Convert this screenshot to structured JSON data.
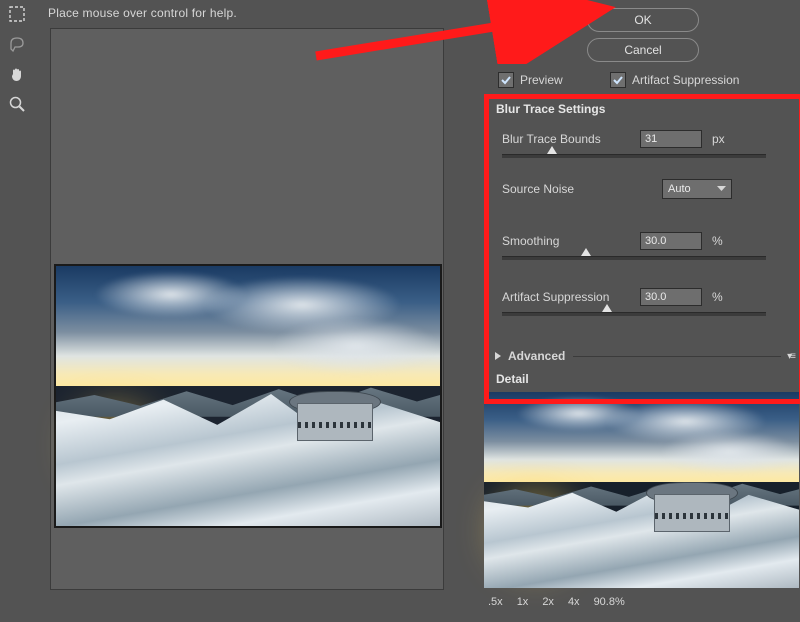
{
  "hint": "Place mouse over control for help.",
  "annotation": {
    "arrow_color": "#ff1a1a"
  },
  "buttons": {
    "ok": "OK",
    "cancel": "Cancel"
  },
  "preview_checkbox": {
    "label": "Preview",
    "checked": true
  },
  "artifact_checkbox": {
    "label": "Artifact Suppression",
    "checked": true
  },
  "blur_trace_settings": {
    "title": "Blur Trace Settings",
    "bounds": {
      "label": "Blur Trace Bounds",
      "value": "31",
      "unit": "px",
      "slider_pos_pct": 17
    },
    "source_noise": {
      "label": "Source Noise",
      "selected": "Auto"
    },
    "smoothing": {
      "label": "Smoothing",
      "value": "30.0",
      "unit": "%",
      "slider_pos_pct": 30
    },
    "artifact": {
      "label": "Artifact Suppression",
      "value": "30.0",
      "unit": "%",
      "slider_pos_pct": 38
    }
  },
  "advanced": {
    "label": "Advanced"
  },
  "detail": {
    "title": "Detail"
  },
  "zoom": {
    "levels": [
      ".5x",
      "1x",
      "2x",
      "4x"
    ],
    "current": "90.8%"
  },
  "tools": [
    "marquee",
    "lasso",
    "hand",
    "zoom"
  ]
}
